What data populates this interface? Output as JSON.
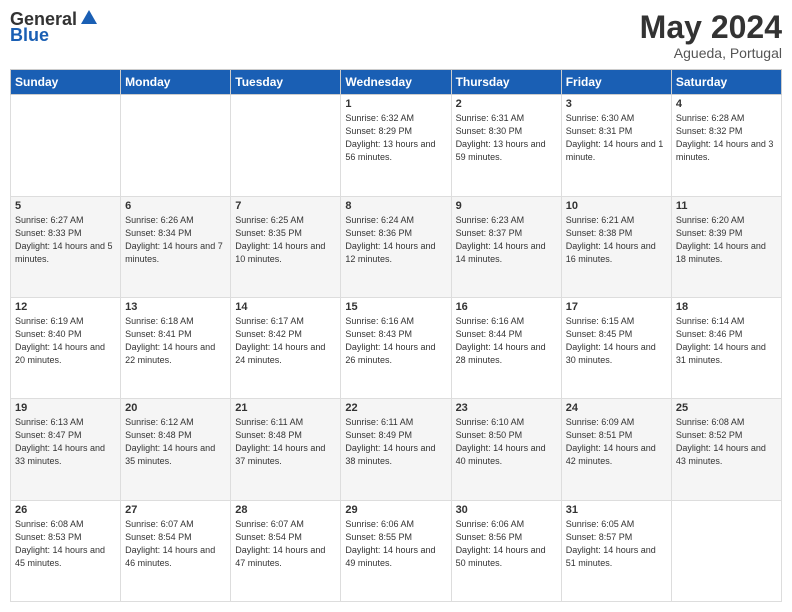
{
  "header": {
    "logo_text_general": "General",
    "logo_text_blue": "Blue",
    "month_title": "May 2024",
    "location": "Agueda, Portugal"
  },
  "days_of_week": [
    "Sunday",
    "Monday",
    "Tuesday",
    "Wednesday",
    "Thursday",
    "Friday",
    "Saturday"
  ],
  "weeks": [
    [
      {
        "day": "",
        "sunrise": "",
        "sunset": "",
        "daylight": ""
      },
      {
        "day": "",
        "sunrise": "",
        "sunset": "",
        "daylight": ""
      },
      {
        "day": "",
        "sunrise": "",
        "sunset": "",
        "daylight": ""
      },
      {
        "day": "1",
        "sunrise": "Sunrise: 6:32 AM",
        "sunset": "Sunset: 8:29 PM",
        "daylight": "Daylight: 13 hours and 56 minutes."
      },
      {
        "day": "2",
        "sunrise": "Sunrise: 6:31 AM",
        "sunset": "Sunset: 8:30 PM",
        "daylight": "Daylight: 13 hours and 59 minutes."
      },
      {
        "day": "3",
        "sunrise": "Sunrise: 6:30 AM",
        "sunset": "Sunset: 8:31 PM",
        "daylight": "Daylight: 14 hours and 1 minute."
      },
      {
        "day": "4",
        "sunrise": "Sunrise: 6:28 AM",
        "sunset": "Sunset: 8:32 PM",
        "daylight": "Daylight: 14 hours and 3 minutes."
      }
    ],
    [
      {
        "day": "5",
        "sunrise": "Sunrise: 6:27 AM",
        "sunset": "Sunset: 8:33 PM",
        "daylight": "Daylight: 14 hours and 5 minutes."
      },
      {
        "day": "6",
        "sunrise": "Sunrise: 6:26 AM",
        "sunset": "Sunset: 8:34 PM",
        "daylight": "Daylight: 14 hours and 7 minutes."
      },
      {
        "day": "7",
        "sunrise": "Sunrise: 6:25 AM",
        "sunset": "Sunset: 8:35 PM",
        "daylight": "Daylight: 14 hours and 10 minutes."
      },
      {
        "day": "8",
        "sunrise": "Sunrise: 6:24 AM",
        "sunset": "Sunset: 8:36 PM",
        "daylight": "Daylight: 14 hours and 12 minutes."
      },
      {
        "day": "9",
        "sunrise": "Sunrise: 6:23 AM",
        "sunset": "Sunset: 8:37 PM",
        "daylight": "Daylight: 14 hours and 14 minutes."
      },
      {
        "day": "10",
        "sunrise": "Sunrise: 6:21 AM",
        "sunset": "Sunset: 8:38 PM",
        "daylight": "Daylight: 14 hours and 16 minutes."
      },
      {
        "day": "11",
        "sunrise": "Sunrise: 6:20 AM",
        "sunset": "Sunset: 8:39 PM",
        "daylight": "Daylight: 14 hours and 18 minutes."
      }
    ],
    [
      {
        "day": "12",
        "sunrise": "Sunrise: 6:19 AM",
        "sunset": "Sunset: 8:40 PM",
        "daylight": "Daylight: 14 hours and 20 minutes."
      },
      {
        "day": "13",
        "sunrise": "Sunrise: 6:18 AM",
        "sunset": "Sunset: 8:41 PM",
        "daylight": "Daylight: 14 hours and 22 minutes."
      },
      {
        "day": "14",
        "sunrise": "Sunrise: 6:17 AM",
        "sunset": "Sunset: 8:42 PM",
        "daylight": "Daylight: 14 hours and 24 minutes."
      },
      {
        "day": "15",
        "sunrise": "Sunrise: 6:16 AM",
        "sunset": "Sunset: 8:43 PM",
        "daylight": "Daylight: 14 hours and 26 minutes."
      },
      {
        "day": "16",
        "sunrise": "Sunrise: 6:16 AM",
        "sunset": "Sunset: 8:44 PM",
        "daylight": "Daylight: 14 hours and 28 minutes."
      },
      {
        "day": "17",
        "sunrise": "Sunrise: 6:15 AM",
        "sunset": "Sunset: 8:45 PM",
        "daylight": "Daylight: 14 hours and 30 minutes."
      },
      {
        "day": "18",
        "sunrise": "Sunrise: 6:14 AM",
        "sunset": "Sunset: 8:46 PM",
        "daylight": "Daylight: 14 hours and 31 minutes."
      }
    ],
    [
      {
        "day": "19",
        "sunrise": "Sunrise: 6:13 AM",
        "sunset": "Sunset: 8:47 PM",
        "daylight": "Daylight: 14 hours and 33 minutes."
      },
      {
        "day": "20",
        "sunrise": "Sunrise: 6:12 AM",
        "sunset": "Sunset: 8:48 PM",
        "daylight": "Daylight: 14 hours and 35 minutes."
      },
      {
        "day": "21",
        "sunrise": "Sunrise: 6:11 AM",
        "sunset": "Sunset: 8:48 PM",
        "daylight": "Daylight: 14 hours and 37 minutes."
      },
      {
        "day": "22",
        "sunrise": "Sunrise: 6:11 AM",
        "sunset": "Sunset: 8:49 PM",
        "daylight": "Daylight: 14 hours and 38 minutes."
      },
      {
        "day": "23",
        "sunrise": "Sunrise: 6:10 AM",
        "sunset": "Sunset: 8:50 PM",
        "daylight": "Daylight: 14 hours and 40 minutes."
      },
      {
        "day": "24",
        "sunrise": "Sunrise: 6:09 AM",
        "sunset": "Sunset: 8:51 PM",
        "daylight": "Daylight: 14 hours and 42 minutes."
      },
      {
        "day": "25",
        "sunrise": "Sunrise: 6:08 AM",
        "sunset": "Sunset: 8:52 PM",
        "daylight": "Daylight: 14 hours and 43 minutes."
      }
    ],
    [
      {
        "day": "26",
        "sunrise": "Sunrise: 6:08 AM",
        "sunset": "Sunset: 8:53 PM",
        "daylight": "Daylight: 14 hours and 45 minutes."
      },
      {
        "day": "27",
        "sunrise": "Sunrise: 6:07 AM",
        "sunset": "Sunset: 8:54 PM",
        "daylight": "Daylight: 14 hours and 46 minutes."
      },
      {
        "day": "28",
        "sunrise": "Sunrise: 6:07 AM",
        "sunset": "Sunset: 8:54 PM",
        "daylight": "Daylight: 14 hours and 47 minutes."
      },
      {
        "day": "29",
        "sunrise": "Sunrise: 6:06 AM",
        "sunset": "Sunset: 8:55 PM",
        "daylight": "Daylight: 14 hours and 49 minutes."
      },
      {
        "day": "30",
        "sunrise": "Sunrise: 6:06 AM",
        "sunset": "Sunset: 8:56 PM",
        "daylight": "Daylight: 14 hours and 50 minutes."
      },
      {
        "day": "31",
        "sunrise": "Sunrise: 6:05 AM",
        "sunset": "Sunset: 8:57 PM",
        "daylight": "Daylight: 14 hours and 51 minutes."
      },
      {
        "day": "",
        "sunrise": "",
        "sunset": "",
        "daylight": ""
      }
    ]
  ]
}
